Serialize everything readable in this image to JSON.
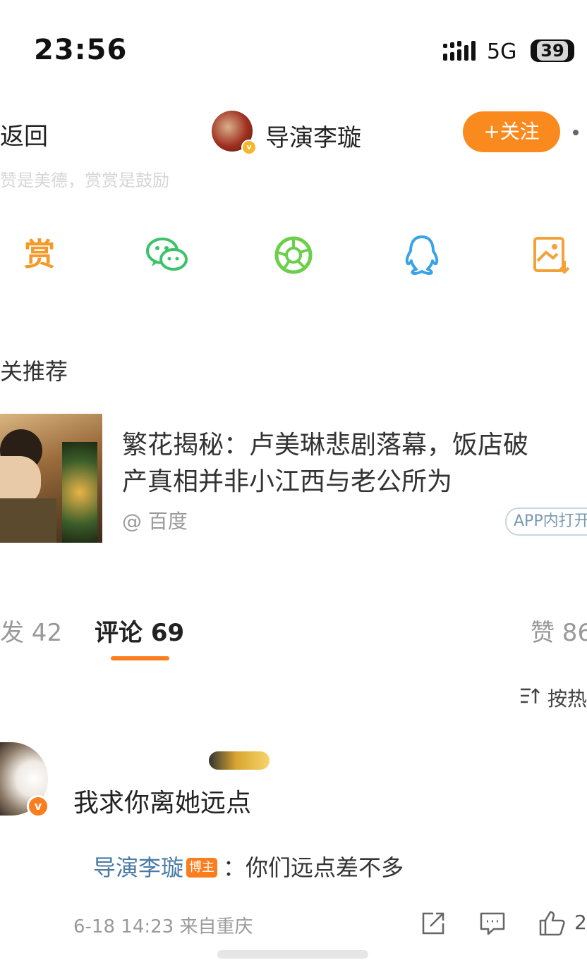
{
  "status_bar": {
    "time": "23:56",
    "network": "5G",
    "battery": "39"
  },
  "nav": {
    "back_label": "返回",
    "author_name": "导演李璇",
    "follow_label": "+关注"
  },
  "reward_note": "赞是美德，赏赏是鼓励",
  "share": {
    "reward_label": "赏",
    "icons": [
      "reward-icon",
      "wechat-icon",
      "moments-icon",
      "qq-icon",
      "save-image-icon"
    ],
    "colors": {
      "reward": "#f39a2b",
      "wechat": "#3cc36a",
      "moments": "#6ccf4b",
      "qq": "#3aa3e8",
      "save": "#f3a23a"
    }
  },
  "related": {
    "section_title": "关推荐",
    "article_title": "繁花揭秘：卢美琳悲剧落幕，饭店破\n产真相并非小江西与老公所为",
    "source": "@ 百度",
    "open_in_app": "APP内打开"
  },
  "tabs": {
    "repost": "发 42",
    "comments": "评论 69",
    "likes": "赞 86"
  },
  "sort_label": "按热",
  "comment": {
    "text": "我求你离她远点",
    "reply_author": "导演李璇",
    "reply_author_badge": "博主",
    "reply_text": "：你们远点差不多",
    "meta": "6-18 14:23  来自重庆",
    "like_count": "2"
  },
  "accent_color": "#fa7d1e"
}
